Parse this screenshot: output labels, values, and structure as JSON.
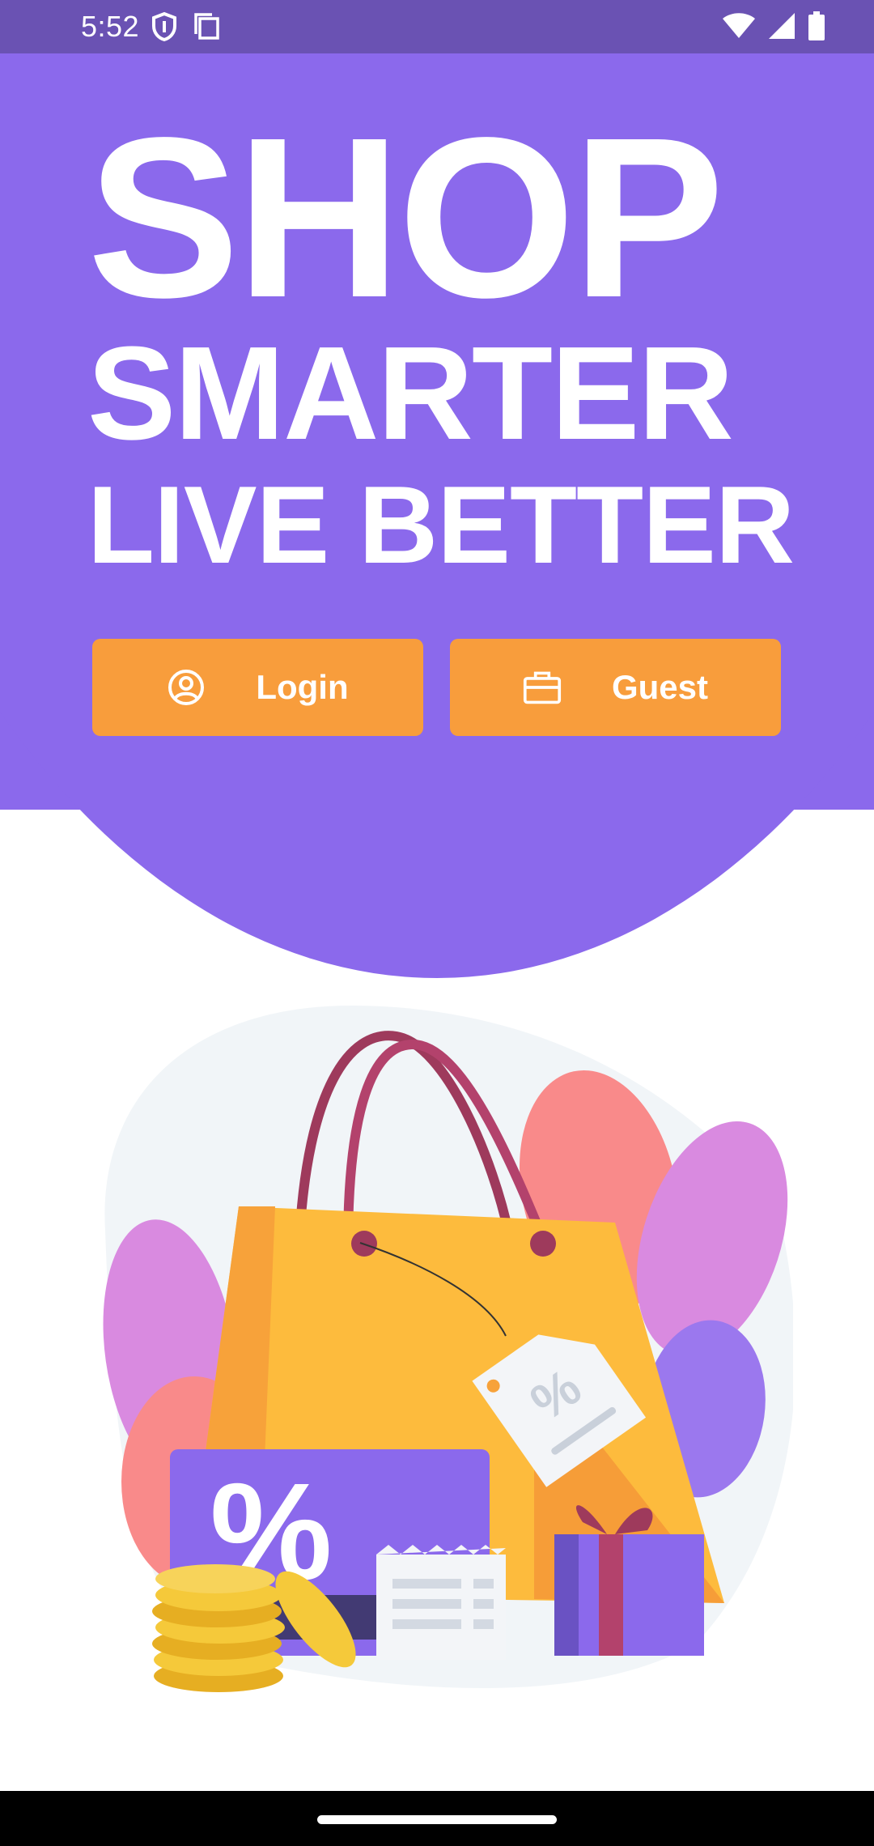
{
  "status_bar": {
    "time": "5:52",
    "left_icons": [
      "shield-icon",
      "screenshot-icon"
    ],
    "right_icons": [
      "wifi-icon",
      "cellular-signal-icon",
      "battery-icon"
    ],
    "background_color": "#6a52b3"
  },
  "hero": {
    "background_color": "#8b69ec",
    "headline_line_1": "SHOP",
    "headline_line_2": "SMARTER",
    "headline_line_3": "LIVE BETTER"
  },
  "buttons": {
    "login_label": "Login",
    "login_icon": "user-circle-icon",
    "guest_label": "Guest",
    "guest_icon": "briefcase-icon",
    "accent_color": "#f89d3c"
  },
  "illustration": {
    "elements": [
      "shopping-bag",
      "discount-tag",
      "discount-card",
      "coins",
      "receipt",
      "gift-box",
      "leaves"
    ],
    "tag_text": "%",
    "card_text": "%"
  }
}
